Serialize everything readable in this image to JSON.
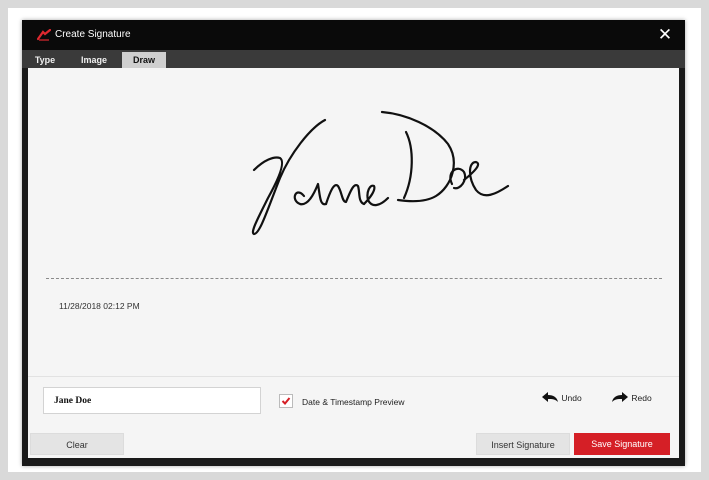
{
  "dialog": {
    "title": "Create Signature",
    "close_glyph": "✕",
    "icons": {
      "logo": "signature-logo-icon",
      "close": "close-icon",
      "undo": "undo-arrow-icon",
      "redo": "redo-arrow-icon",
      "check": "checkmark-icon"
    },
    "colors": {
      "accent": "#d51f26",
      "titlebar": "#0a0a0a",
      "tabbar": "#3a3a3a",
      "active_tab": "#cfcfcf"
    }
  },
  "tabs": [
    {
      "label": "Type",
      "active": false
    },
    {
      "label": "Image",
      "active": false
    },
    {
      "label": "Draw",
      "active": true
    }
  ],
  "canvas": {
    "signature_text": "Jane Doe",
    "timestamp": "11/28/2018 02:12 PM"
  },
  "controls": {
    "name_value": "Jane Doe",
    "timestamp_checkbox_checked": true,
    "timestamp_checkbox_label": "Date & Timestamp Preview",
    "undo_label": "Undo",
    "redo_label": "Redo"
  },
  "footer": {
    "clear_label": "Clear",
    "insert_label": "Insert Signature",
    "save_label": "Save Signature"
  }
}
